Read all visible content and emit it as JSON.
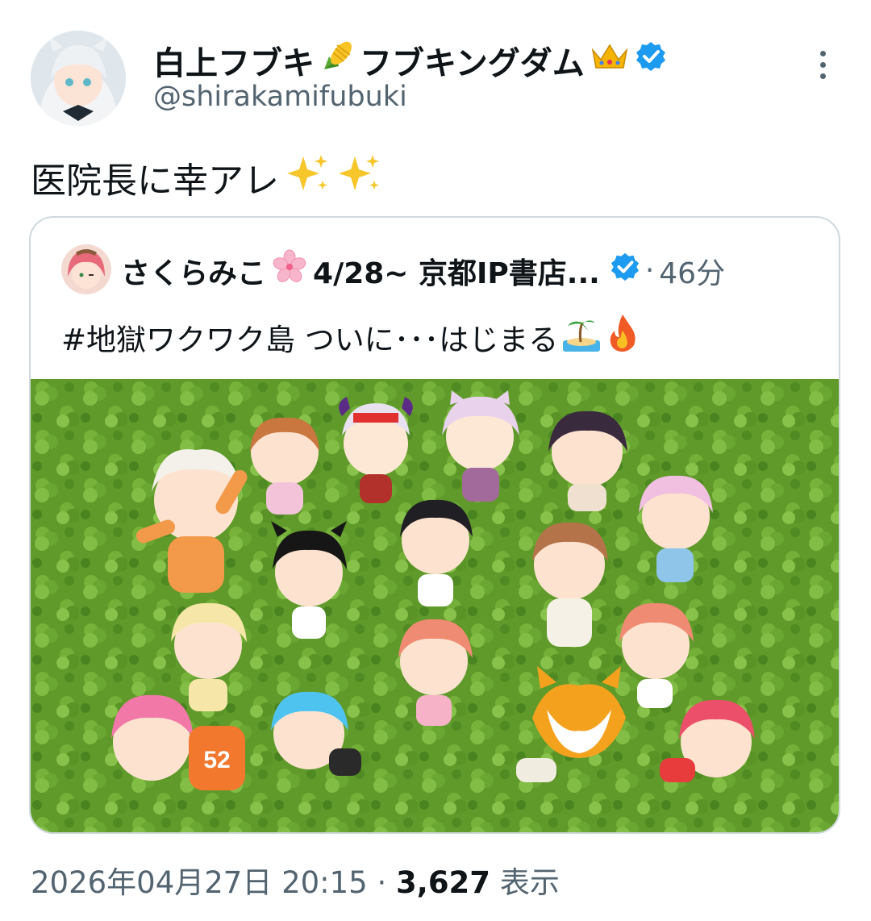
{
  "author": {
    "name": "白上フブキ",
    "name_suffix": "フブキングダム",
    "handle": "@shirakamifubuki"
  },
  "tweet": {
    "text": "医院長に幸アレ"
  },
  "quote": {
    "name": "さくらみこ",
    "name_suffix": "4/28~ 京都IP書店...",
    "separator": "·",
    "time": "46分",
    "text": "#地獄ワクワク島 ついに･･･はじまる"
  },
  "meta": {
    "datetime": "2026年04月27日 20:15",
    "separator": "·",
    "views": "3,627",
    "views_label": "表示"
  },
  "icons": [
    "corn-icon",
    "crown-icon",
    "verified-icon",
    "sparkles-icon",
    "cherry-blossom-icon",
    "island-icon",
    "fire-icon",
    "more-icon"
  ],
  "colors": {
    "verified": "#1d9bf0",
    "secondary_text": "#536471",
    "border": "#cfd9de",
    "grass": "#5f9a2a"
  },
  "jersey_number": "52"
}
